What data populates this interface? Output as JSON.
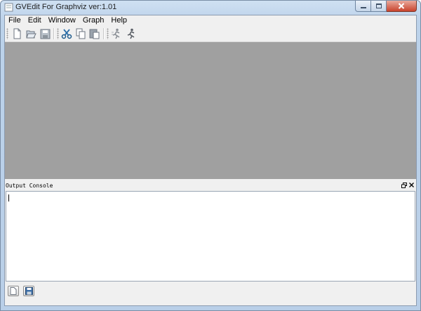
{
  "window": {
    "title": "GVEdit For Graphviz ver:1.01",
    "controls": {
      "minimize_icon": "minimize-icon",
      "maximize_icon": "maximize-icon",
      "close_icon": "close-icon",
      "close_color": "#c8432c"
    }
  },
  "menubar": {
    "items": [
      "File",
      "Edit",
      "Window",
      "Graph",
      "Help"
    ]
  },
  "toolbar": {
    "tools": [
      "new-file-icon",
      "open-file-icon",
      "save-file-icon",
      "cut-icon",
      "copy-icon",
      "paste-icon",
      "layout-run-icon",
      "run-icon"
    ]
  },
  "workspace": {
    "background": "#a0a0a0"
  },
  "output_console": {
    "title": "Output Console",
    "text": ""
  },
  "bottom_bar": {
    "buttons": [
      "new-output-icon",
      "save-output-icon"
    ]
  }
}
